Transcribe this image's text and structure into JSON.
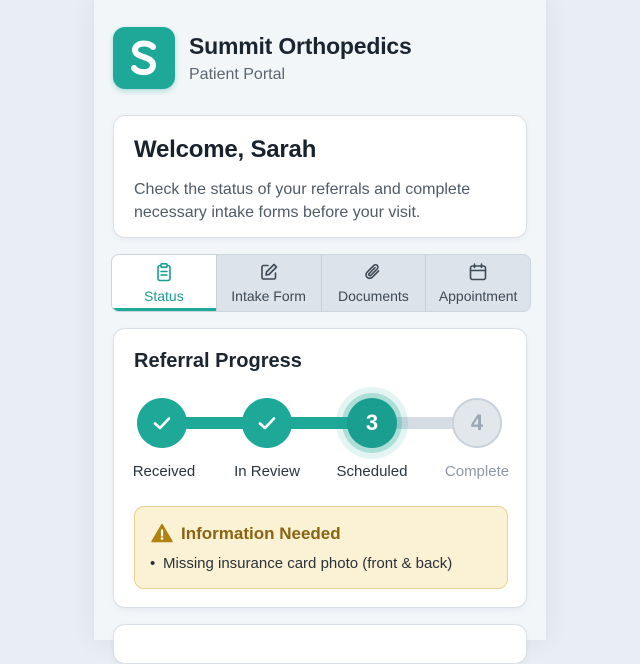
{
  "brand": {
    "logo_letter": "S",
    "name": "Summit Orthopedics",
    "subtitle": "Patient Portal",
    "color": "#1ea898"
  },
  "welcome": {
    "title": "Welcome, Sarah",
    "message": "Check the status of your referrals and complete necessary intake forms before your visit."
  },
  "tabs": [
    {
      "label": "Status",
      "icon": "clipboard-icon",
      "active": true
    },
    {
      "label": "Intake Form",
      "icon": "edit-icon",
      "active": false
    },
    {
      "label": "Documents",
      "icon": "paperclip-icon",
      "active": false
    },
    {
      "label": "Appointment",
      "icon": "calendar-icon",
      "active": false
    }
  ],
  "progress": {
    "title": "Referral Progress",
    "steps": [
      {
        "label": "Received",
        "state": "done"
      },
      {
        "label": "In Review",
        "state": "done"
      },
      {
        "label": "Scheduled",
        "state": "current",
        "number": "3"
      },
      {
        "label": "Complete",
        "state": "todo",
        "number": "4"
      }
    ]
  },
  "alert": {
    "title": "Information Needed",
    "items": [
      "Missing insurance card photo (front & back)"
    ],
    "color": "#8a6410"
  }
}
